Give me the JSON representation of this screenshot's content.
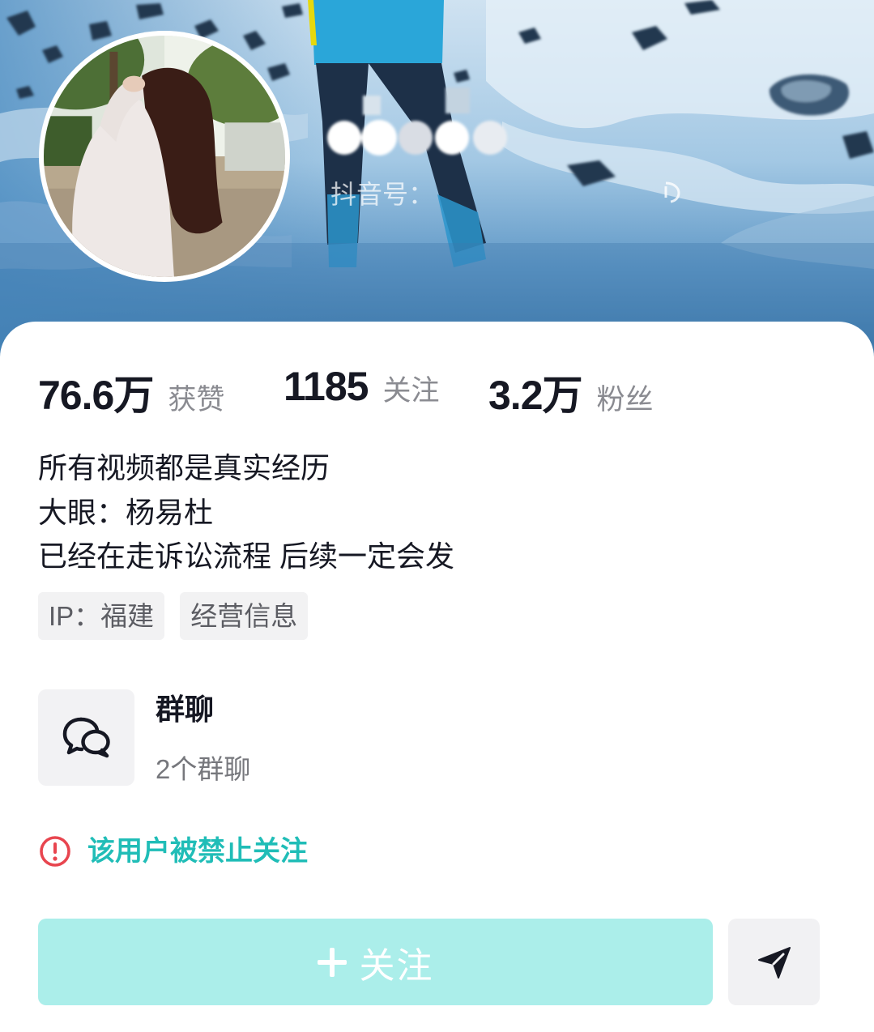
{
  "header": {
    "id_label": "抖音号：",
    "id_icon": "copy-icon",
    "avatar_icon": "profile-photo"
  },
  "stats": [
    {
      "value": "76.6万",
      "label": "获赞"
    },
    {
      "value": "1185",
      "label": "关注"
    },
    {
      "value": "3.2万",
      "label": "粉丝"
    }
  ],
  "bio": [
    "所有视频都是真实经历",
    "大眼：杨易杜",
    "已经在走诉讼流程 后续一定会发"
  ],
  "tags": [
    "IP：福建",
    "经营信息"
  ],
  "group_chat": {
    "icon": "chat-bubbles-icon",
    "title": "群聊",
    "subtitle": "2个群聊"
  },
  "notice": {
    "icon": "alert-circle-icon",
    "text": "该用户被禁止关注"
  },
  "actions": {
    "follow_icon": "plus-icon",
    "follow_label": "关注",
    "share_icon": "send-icon"
  },
  "colors": {
    "text_primary": "#161823",
    "text_secondary": "#8a8b91",
    "accent_teal": "#20bdb7",
    "follow_button_bg": "#abeeea",
    "alert_red": "#e8454f",
    "chip_bg": "#f2f2f3"
  }
}
